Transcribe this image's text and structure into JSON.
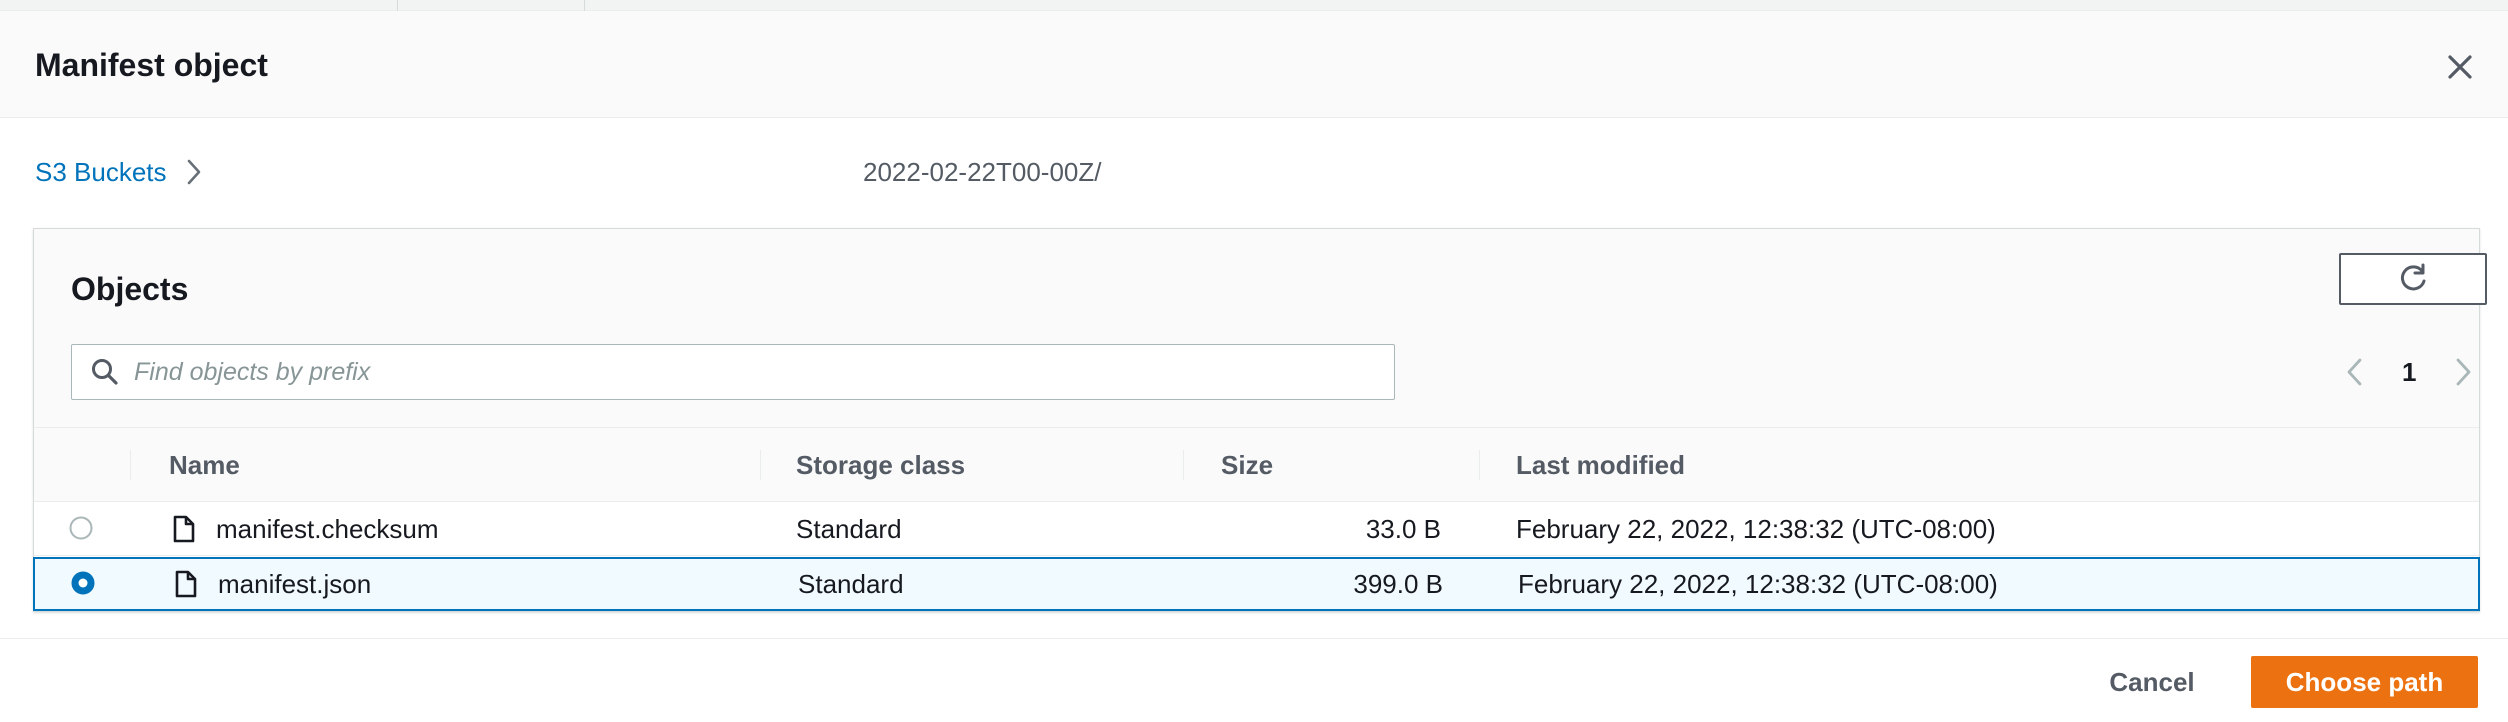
{
  "dialog": {
    "title": "Manifest object",
    "close_icon": "close-icon"
  },
  "breadcrumb": {
    "root_label": "S3 Buckets",
    "current_prefix": "2022-02-22T00-00Z/"
  },
  "objects_panel": {
    "title": "Objects",
    "refresh_icon": "refresh-icon",
    "search": {
      "placeholder": "Find objects by prefix",
      "value": ""
    },
    "pagination": {
      "current_page": "1"
    },
    "columns": [
      "Name",
      "Storage class",
      "Size",
      "Last modified"
    ],
    "rows": [
      {
        "name": "manifest.checksum",
        "storage_class": "Standard",
        "size": "33.0 B",
        "last_modified": "February 22, 2022, 12:38:32 (UTC-08:00)",
        "selected": false
      },
      {
        "name": "manifest.json",
        "storage_class": "Standard",
        "size": "399.0 B",
        "last_modified": "February 22, 2022, 12:38:32 (UTC-08:00)",
        "selected": true
      }
    ]
  },
  "footer": {
    "cancel_label": "Cancel",
    "choose_label": "Choose path"
  },
  "colors": {
    "accent_link": "#0073bb",
    "primary_button": "#ec7211",
    "selected_row_bg": "#f1faff",
    "selected_row_border": "#0073bb"
  }
}
